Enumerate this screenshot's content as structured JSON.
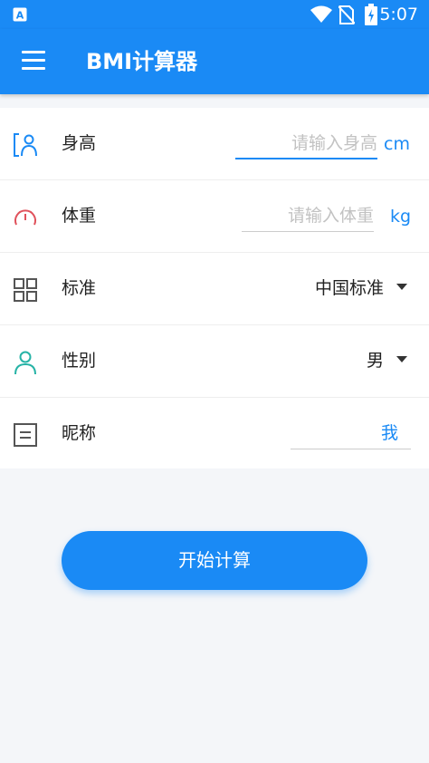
{
  "status_bar": {
    "time": "5:07",
    "icons": [
      "app-notification-icon",
      "wifi-icon",
      "no-sim-icon",
      "battery-charging-icon"
    ]
  },
  "app_bar": {
    "title": "BMI计算器",
    "menu_icon": "menu-icon"
  },
  "form": {
    "height": {
      "label": "身高",
      "placeholder": "请输入身高",
      "value": "",
      "unit": "cm",
      "icon": "height-person-icon"
    },
    "weight": {
      "label": "体重",
      "placeholder": "请输入体重",
      "value": "",
      "unit": "kg",
      "icon": "gauge-icon"
    },
    "standard": {
      "label": "标准",
      "selected": "中国标准",
      "icon": "grid-icon"
    },
    "gender": {
      "label": "性别",
      "selected": "男",
      "icon": "person-icon"
    },
    "nickname": {
      "label": "昵称",
      "value": "我",
      "icon": "form-box-icon"
    }
  },
  "actions": {
    "start_label": "开始计算"
  },
  "colors": {
    "primary": "#1a8af5",
    "weight_icon": "#e0525c",
    "gender_icon": "#26b3a6",
    "field_line": "#cccccc"
  }
}
